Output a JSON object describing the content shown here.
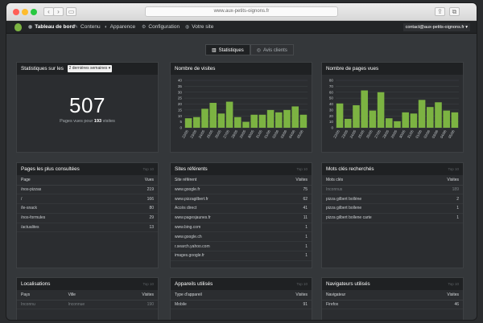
{
  "browser": {
    "url": "www.aux-petits-oignons.fr",
    "window_colors": {
      "close": "#ff5f57",
      "minimize": "#febc2e",
      "maximize": "#28c840"
    }
  },
  "nav": {
    "items": [
      {
        "label": "Tableau de bord",
        "icon": "dashboard-icon",
        "active": true
      },
      {
        "label": "Contenu",
        "icon": "pencil-icon",
        "active": false
      },
      {
        "label": "Apparence",
        "icon": "palette-icon",
        "active": false
      },
      {
        "label": "Configuration",
        "icon": "gear-icon",
        "active": false
      },
      {
        "label": "Votre site",
        "icon": "globe-icon",
        "active": false
      }
    ],
    "account": "contact@aux-petits-oignons.fr ▾"
  },
  "tabs": [
    {
      "label": "Statistiques",
      "icon": "bar-chart-icon",
      "active": true
    },
    {
      "label": "Avis clients",
      "icon": "eye-icon",
      "active": false
    }
  ],
  "stats": {
    "title": "Statistiques sur les",
    "period": "2 dernières semaines ▾",
    "big_number": "507",
    "sub_prefix": "Pages vues pour",
    "sub_count": "193",
    "sub_suffix": "visites"
  },
  "colors": {
    "bar": "#7cb342",
    "accent": "#7cb342"
  },
  "chart_data": [
    {
      "type": "bar",
      "title": "Nombre de visites",
      "categories": [
        "22/05",
        "23/05",
        "24/05",
        "25/05",
        "26/05",
        "27/05",
        "28/05",
        "29/05",
        "30/05",
        "31/05",
        "01/06",
        "02/06",
        "03/06",
        "04/06",
        "05/06"
      ],
      "values": [
        8,
        9,
        16,
        21,
        12,
        22,
        9,
        5,
        11,
        11,
        15,
        13,
        15,
        18,
        11
      ],
      "ylim": [
        0,
        40
      ],
      "yticks": [
        0,
        5,
        10,
        15,
        20,
        25,
        30,
        35,
        40
      ],
      "grid": true
    },
    {
      "type": "bar",
      "title": "Nombre de pages vues",
      "categories": [
        "22/05",
        "23/05",
        "24/05",
        "25/05",
        "26/05",
        "27/05",
        "28/05",
        "29/05",
        "30/05",
        "31/05",
        "01/06",
        "02/06",
        "03/06",
        "04/06",
        "05/06"
      ],
      "values": [
        41,
        15,
        38,
        63,
        29,
        60,
        16,
        11,
        26,
        24,
        47,
        35,
        43,
        29,
        26
      ],
      "ylim": [
        0,
        80
      ],
      "yticks": [
        0,
        10,
        20,
        30,
        40,
        50,
        60,
        70,
        80
      ],
      "grid": true
    }
  ],
  "pages": {
    "title": "Pages les plus consultées",
    "top": "Top 10",
    "headers": [
      "Page",
      "Vues"
    ],
    "rows": [
      [
        "/nos-pizzas",
        "219"
      ],
      [
        "/",
        "166"
      ],
      [
        "/le-snack",
        "80"
      ],
      [
        "/nos-formules",
        "29"
      ],
      [
        "/actualites",
        "13"
      ]
    ]
  },
  "referrers": {
    "title": "Sites référents",
    "top": "Top 10",
    "headers": [
      "Site référent",
      "Visites"
    ],
    "rows": [
      [
        "www.google.fr",
        "75"
      ],
      [
        "www.pizzagilbert.fr",
        "62"
      ],
      [
        "Accès direct",
        "41"
      ],
      [
        "www.pagesjaunes.fr",
        "11"
      ],
      [
        "www.bing.com",
        "1"
      ],
      [
        "www.google.ch",
        "1"
      ],
      [
        "r.search.yahoo.com",
        "1"
      ],
      [
        "images.google.fr",
        "1"
      ]
    ]
  },
  "keywords": {
    "title": "Mots clés recherchés",
    "top": "Top 10",
    "headers": [
      "Mots clés",
      "Visites"
    ],
    "rows": [
      [
        "Inconnus",
        "189"
      ],
      [
        "pizza gilbert bollène",
        "2"
      ],
      [
        "pizza gilbert bollene",
        "1"
      ],
      [
        "pizza gilbert bollene carte",
        "1"
      ]
    ]
  },
  "locations": {
    "title": "Localisations",
    "top": "Top 10",
    "headers": [
      "Pays",
      "Ville",
      "Visites"
    ],
    "rows": [
      [
        "Inconnu",
        "Inconnue",
        "190"
      ]
    ]
  },
  "devices": {
    "title": "Appareils utilisés",
    "top": "Top 10",
    "headers": [
      "Type d'appareil",
      "Visites"
    ],
    "rows": [
      [
        "Mobile",
        "91"
      ]
    ]
  },
  "browsers": {
    "title": "Navigateurs utilisés",
    "top": "Top 10",
    "headers": [
      "Navigateur",
      "Visites"
    ],
    "rows": [
      [
        "Firefox",
        "46"
      ]
    ]
  }
}
